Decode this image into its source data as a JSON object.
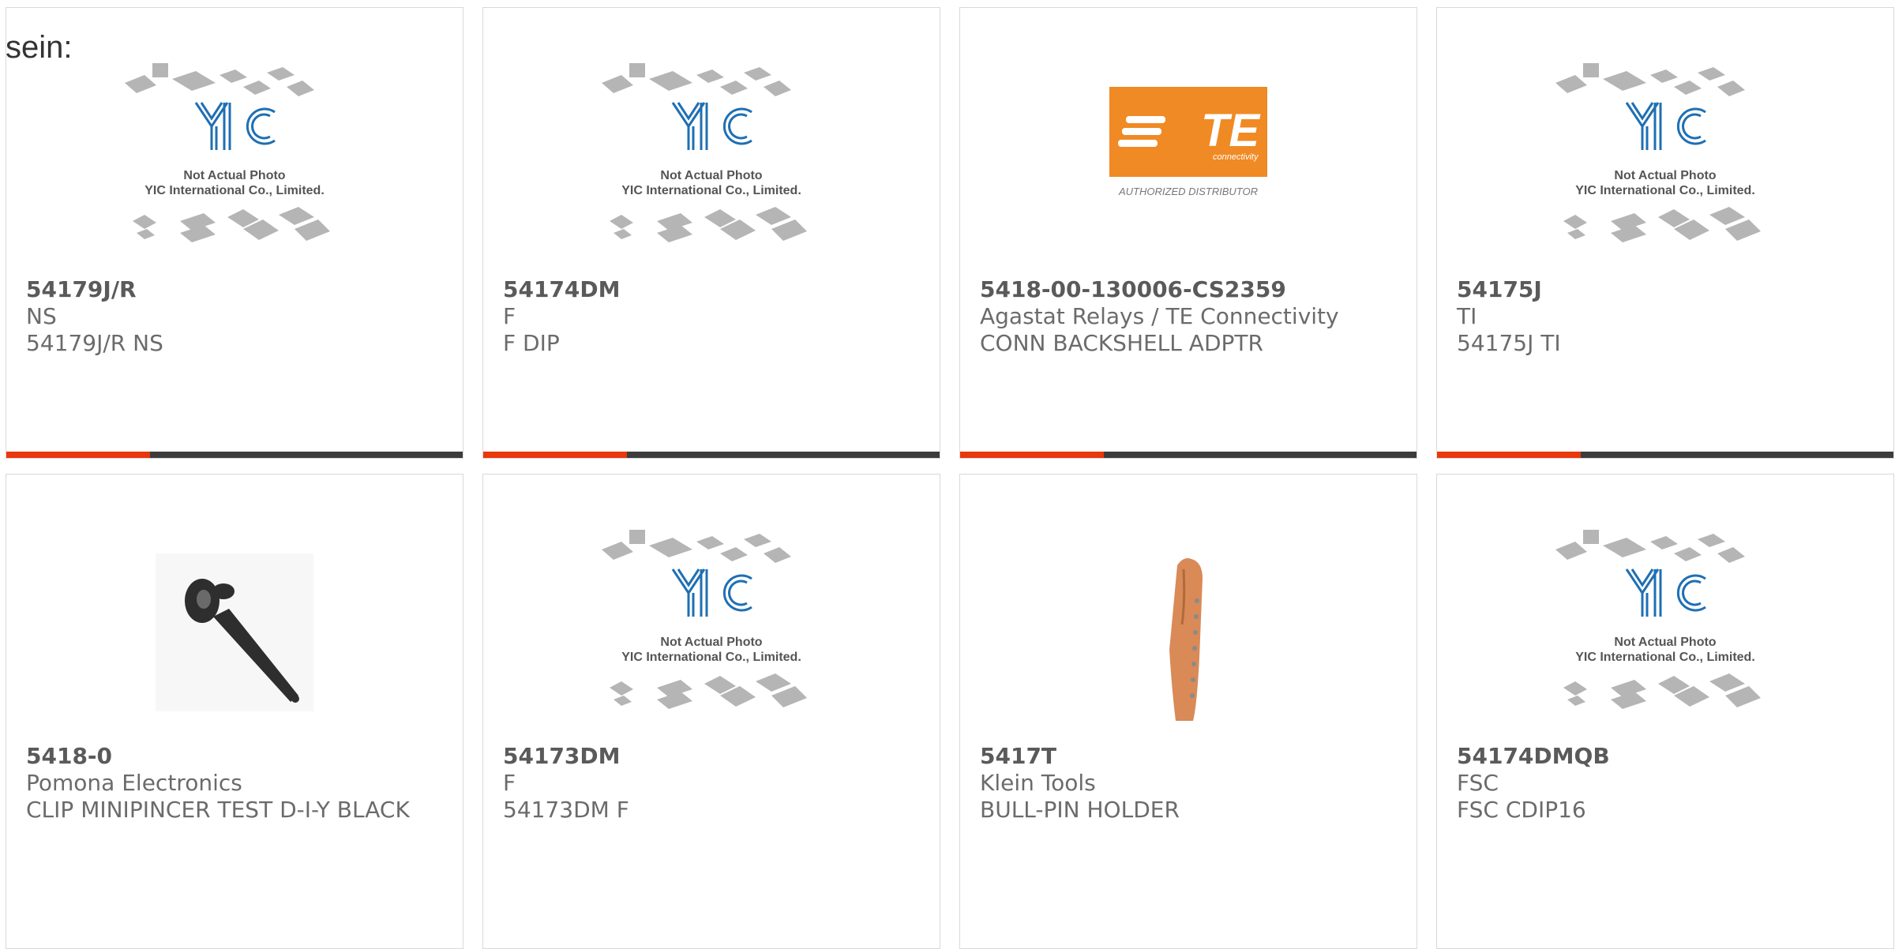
{
  "intro_text": "sein:",
  "placeholder_photo": {
    "line1": "Not Actual Photo",
    "line2": "YIC International Co., Limited.",
    "brand": "YIC"
  },
  "te_logo": {
    "text": "TE",
    "sub": "connectivity",
    "caption": "AUTHORIZED DISTRIBUTOR"
  },
  "colors": {
    "accent": "#e8380d",
    "bar": "#3c3c3c",
    "te_orange": "#f08a24",
    "yic_blue": "#1f6fb3"
  },
  "products": [
    {
      "part": "54179J/R",
      "maker": "NS",
      "desc": "54179J/R NS",
      "image": "yic-placeholder"
    },
    {
      "part": "54174DM",
      "maker": "F",
      "desc": "F DIP",
      "image": "yic-placeholder"
    },
    {
      "part": "5418-00-130006-CS2359",
      "maker": "Agastat Relays / TE Connectivity",
      "desc": "CONN BACKSHELL ADPTR",
      "image": "te-logo"
    },
    {
      "part": "54175J",
      "maker": "TI",
      "desc": "54175J TI",
      "image": "yic-placeholder"
    },
    {
      "part": "5418-0",
      "maker": "Pomona Electronics",
      "desc": "CLIP MINIPINCER TEST D-I-Y BLACK",
      "image": "test-clip"
    },
    {
      "part": "54173DM",
      "maker": "F",
      "desc": "54173DM F",
      "image": "yic-placeholder"
    },
    {
      "part": "5417T",
      "maker": "Klein Tools",
      "desc": "BULL-PIN HOLDER",
      "image": "leather-holder"
    },
    {
      "part": "54174DMQB",
      "maker": "FSC",
      "desc": "FSC CDIP16",
      "image": "yic-placeholder"
    }
  ]
}
